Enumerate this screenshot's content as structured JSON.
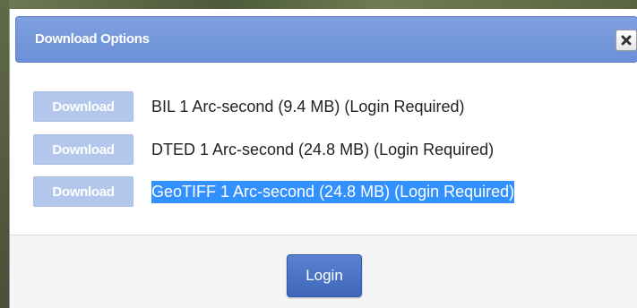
{
  "dialog": {
    "title": "Download Options",
    "close_icon": "close-icon"
  },
  "downloads": [
    {
      "button_label": "Download",
      "label": "BIL 1 Arc-second (9.4 MB) (Login Required)",
      "selected": false
    },
    {
      "button_label": "Download",
      "label": "DTED 1 Arc-second (24.8 MB) (Login Required)",
      "selected": false
    },
    {
      "button_label": "Download",
      "label": "GeoTIFF 1 Arc-second (24.8 MB) (Login Required)",
      "selected": true
    }
  ],
  "footer": {
    "login_label": "Login"
  },
  "colors": {
    "titlebar": "#7393da",
    "download_button_disabled": "#b3c7ec",
    "login_button": "#4a72c4",
    "selection": "#3390ff"
  }
}
